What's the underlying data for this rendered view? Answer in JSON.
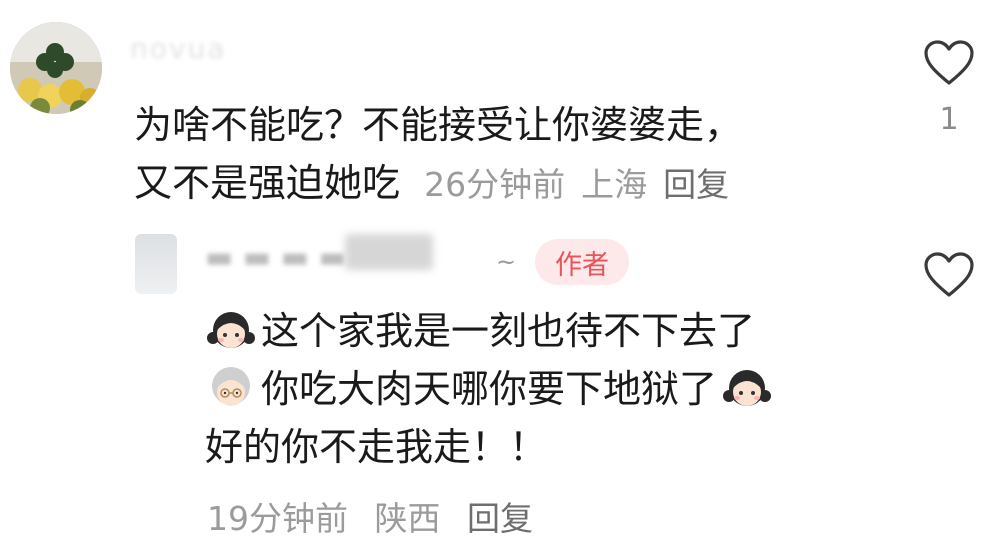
{
  "comment": {
    "username": "novua",
    "line1": "为啥不能吃？不能接受让你婆婆走，",
    "line2": "又不是强迫她吃",
    "time": "26分钟前",
    "location": "上海",
    "reply_label": "回复",
    "like_count": "1"
  },
  "reply": {
    "author_badge": "作者",
    "line1": "这个家我是一刻也待不下去了",
    "line2": "你吃大肉天哪你要下地狱了",
    "line3": "好的你不走我走！！",
    "time": "19分钟前",
    "location": "陕西",
    "reply_label": "回复",
    "tilde": "~"
  },
  "icons": {
    "like": "heart-outline-icon",
    "girl": "girl-emoji",
    "grandma": "old-woman-emoji"
  },
  "colors": {
    "badge_bg": "#fde8ea",
    "badge_text": "#e8545a",
    "meta_text": "#9b9b9b"
  }
}
